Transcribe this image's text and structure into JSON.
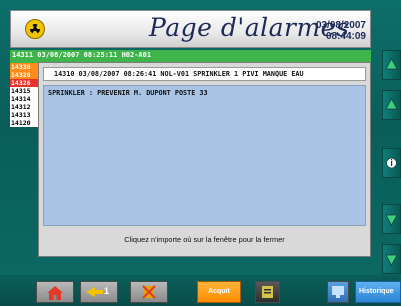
{
  "header": {
    "title": "Page d'alarmes",
    "date": "03/08/2007",
    "time": "08:44:09",
    "icon": "radiation-icon"
  },
  "event_bar": {
    "line": "14311 03/08/2007 08:25:11 H02-A01"
  },
  "id_column": [
    "14330",
    "14328",
    "14326",
    "14315",
    "14314",
    "14312",
    "14313",
    "14120"
  ],
  "popup": {
    "header_line": "14310 03/08/2007 08:26:41 NOL-V01 SPRINKLER 1  PIVI MANQUE EAU",
    "body_line": "SPRINKLER : PREVENIR M. DUPONT POSTE 33",
    "footer_text": "Cliquez n'importe où sur la fenêtre pour la fermer"
  },
  "footer": {
    "acquit_label": "Acquit",
    "historique_label": "Historique",
    "page_number": "1"
  },
  "colors": {
    "background": "#0b6a64",
    "event_green": "#3fb44a",
    "acquit_orange": "#ff8b00",
    "body_blue": "#a9c4e4"
  }
}
